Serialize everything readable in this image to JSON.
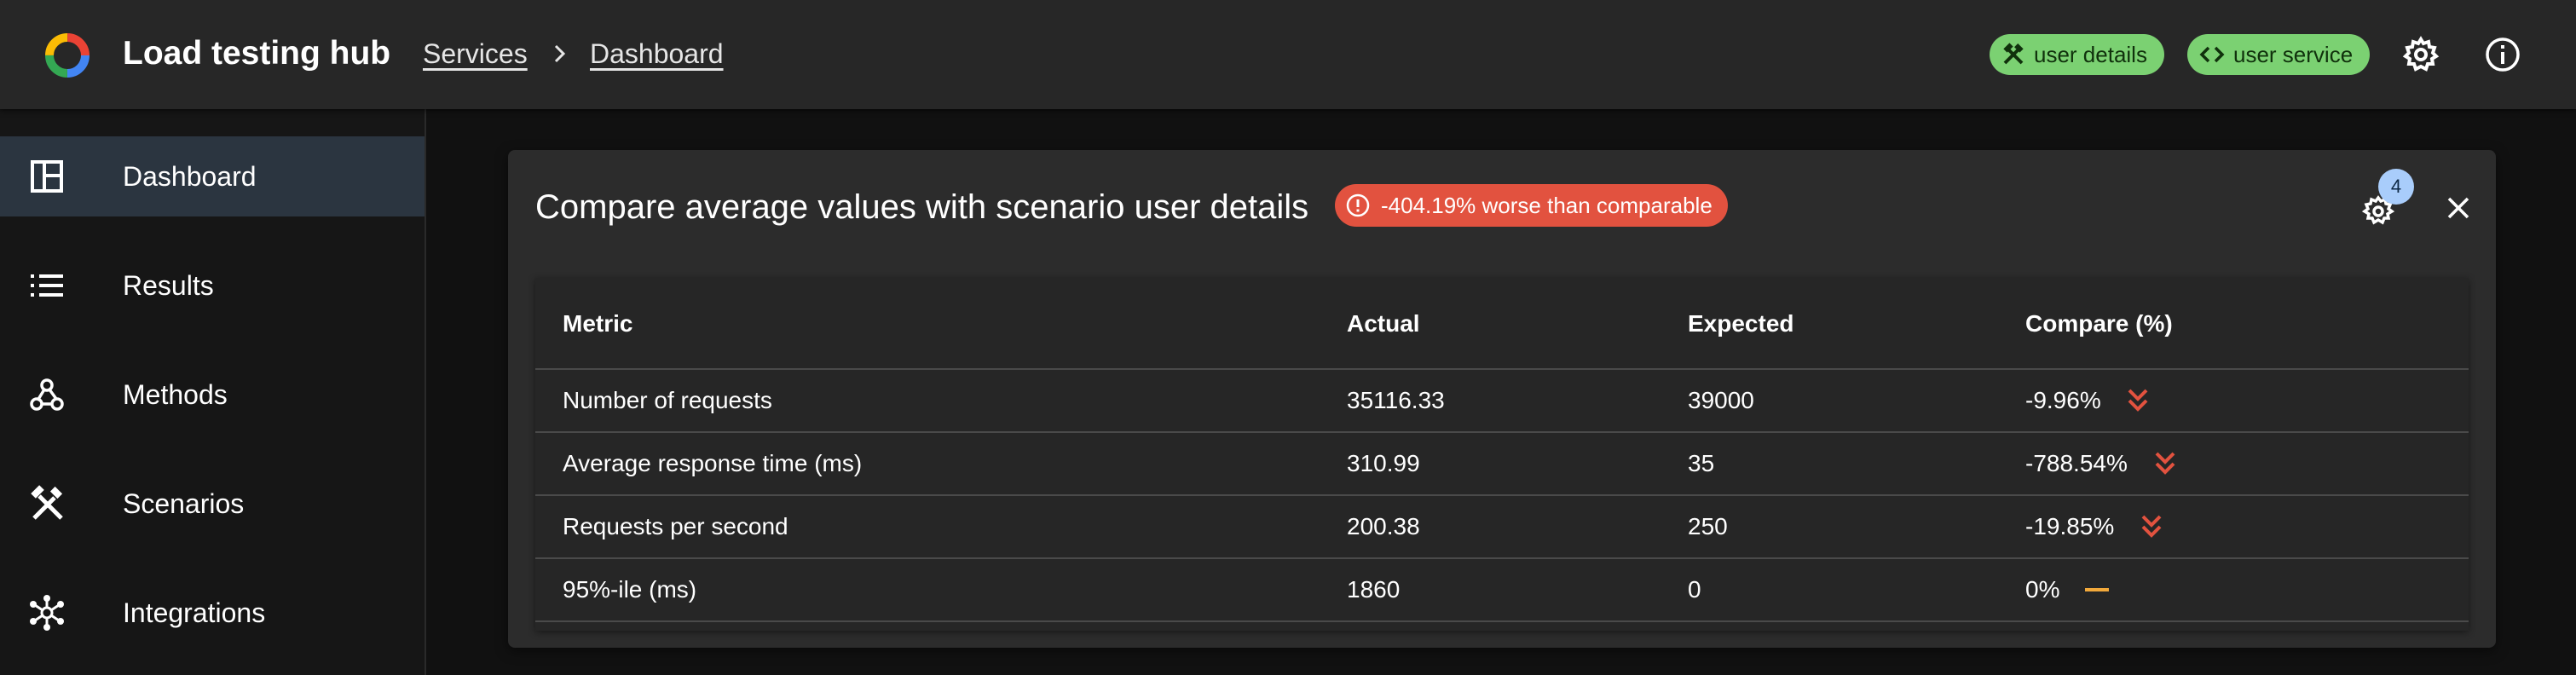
{
  "colors": {
    "background": "#111111",
    "topbar": "#272727",
    "sidebar": "#161616",
    "active_nav": "#2b3540",
    "card": "#2c2c2c",
    "chip_green": "#7bd172",
    "error_red": "#e2523f",
    "count_badge": "#a9cdfb",
    "trend_down": "#e2523f",
    "trend_neutral": "#f2a93b"
  },
  "header": {
    "logo_icon": "app-logo-icon",
    "title": "Load testing hub",
    "breadcrumbs": [
      "Services",
      "Dashboard"
    ],
    "chips": [
      {
        "label": "user details",
        "icon": "scenario-tools-icon"
      },
      {
        "label": "user service",
        "icon": "code-brackets-icon"
      }
    ],
    "actions": [
      {
        "icon": "gear-icon"
      },
      {
        "icon": "info-icon"
      }
    ]
  },
  "sidebar": {
    "items": [
      {
        "label": "Dashboard",
        "icon": "dashboard-icon",
        "active": true
      },
      {
        "label": "Results",
        "icon": "list-icon",
        "active": false
      },
      {
        "label": "Methods",
        "icon": "webhook-icon",
        "active": false
      },
      {
        "label": "Scenarios",
        "icon": "tools-icon",
        "active": false
      },
      {
        "label": "Integrations",
        "icon": "hub-icon",
        "active": false
      }
    ]
  },
  "card": {
    "title": "Compare average values with scenario user details",
    "status_badge": "-404.19% worse than comparable",
    "settings_count": "4",
    "table": {
      "headers": [
        "Metric",
        "Actual",
        "Expected",
        "Compare (%)"
      ],
      "rows": [
        {
          "metric": "Number of requests",
          "actual": "35116.33",
          "expected": "39000",
          "compare": "-9.96%",
          "trend": "down"
        },
        {
          "metric": "Average response time (ms)",
          "actual": "310.99",
          "expected": "35",
          "compare": "-788.54%",
          "trend": "down"
        },
        {
          "metric": "Requests per second",
          "actual": "200.38",
          "expected": "250",
          "compare": "-19.85%",
          "trend": "down"
        },
        {
          "metric": "95%-ile (ms)",
          "actual": "1860",
          "expected": "0",
          "compare": "0%",
          "trend": "neutral"
        }
      ]
    }
  }
}
